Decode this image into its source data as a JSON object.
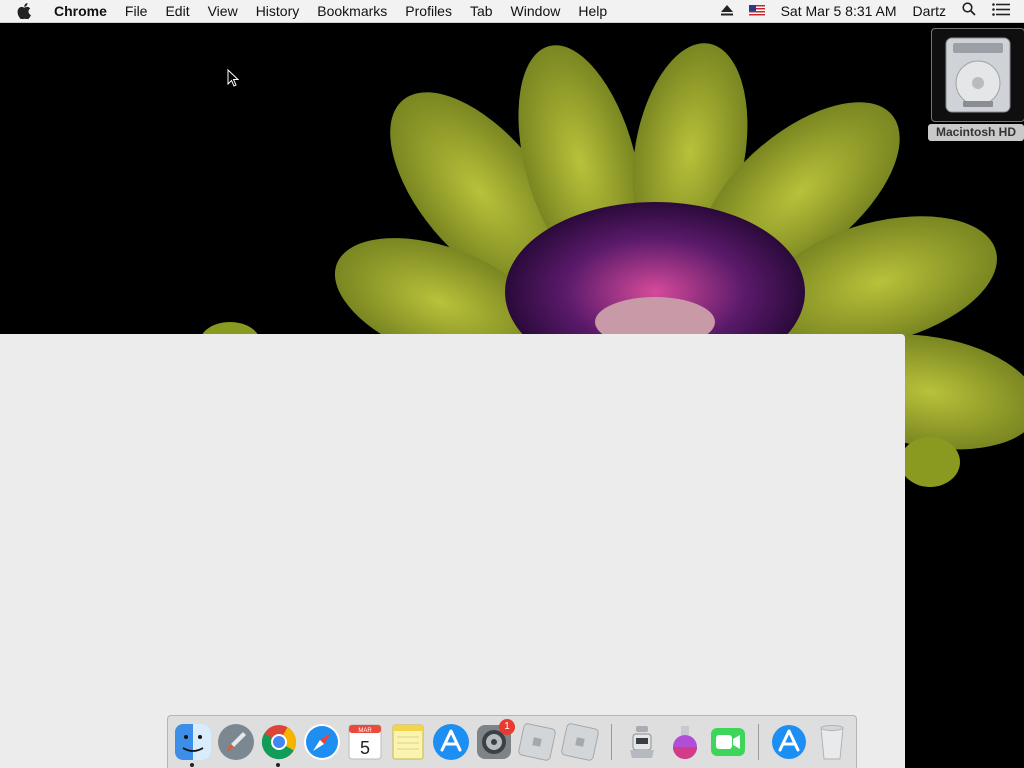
{
  "menubar": {
    "apple_icon": "apple-icon",
    "app_name": "Chrome",
    "items": [
      "File",
      "Edit",
      "View",
      "History",
      "Bookmarks",
      "Profiles",
      "Tab",
      "Window",
      "Help"
    ],
    "status": {
      "eject_icon": "eject-icon",
      "flag_icon": "us-flag-icon",
      "datetime": "Sat Mar 5  8:31 AM",
      "user": "Dartz",
      "search_icon": "spotlight-icon",
      "notifications_icon": "notification-center-icon"
    }
  },
  "desktop": {
    "drive_label": "Macintosh HD"
  },
  "dock": {
    "items": [
      {
        "name": "Finder",
        "icon": "finder-icon"
      },
      {
        "name": "Launchpad",
        "icon": "launchpad-icon"
      },
      {
        "name": "Google Chrome",
        "icon": "chrome-icon"
      },
      {
        "name": "Safari",
        "icon": "safari-icon"
      },
      {
        "name": "Calendar",
        "icon": "calendar-icon",
        "month": "MAR",
        "day": "5"
      },
      {
        "name": "Notes",
        "icon": "notes-icon"
      },
      {
        "name": "App Store",
        "icon": "app-store-icon"
      },
      {
        "name": "System Preferences",
        "icon": "system-preferences-icon",
        "badge": "1"
      },
      {
        "name": "Roblox",
        "icon": "roblox-icon"
      },
      {
        "name": "Roblox Studio",
        "icon": "roblox-studio-icon"
      },
      {
        "name": "Automator",
        "icon": "automator-icon"
      },
      {
        "name": "Potion",
        "icon": "potion-icon"
      },
      {
        "name": "FaceTime",
        "icon": "facetime-icon"
      },
      {
        "name": "App Store Downloads",
        "icon": "app-store-downloads-icon"
      },
      {
        "name": "Trash",
        "icon": "trash-icon"
      }
    ]
  }
}
